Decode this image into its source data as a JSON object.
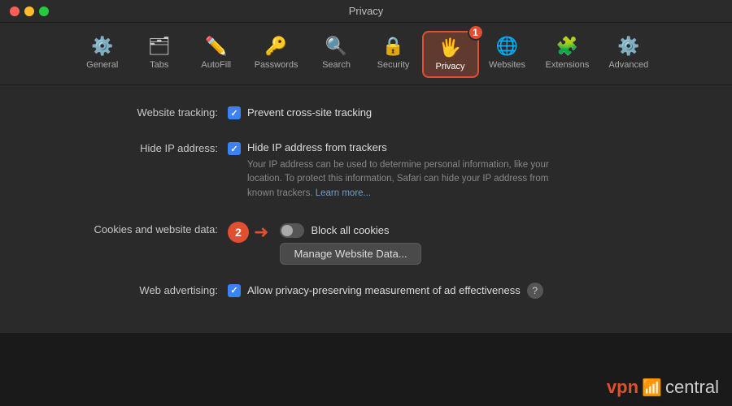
{
  "titlebar": {
    "title": "Privacy"
  },
  "toolbar": {
    "items": [
      {
        "id": "general",
        "label": "General",
        "icon": "⚙️"
      },
      {
        "id": "tabs",
        "label": "Tabs",
        "icon": "🗂"
      },
      {
        "id": "autofill",
        "label": "AutoFill",
        "icon": "✏️"
      },
      {
        "id": "passwords",
        "label": "Passwords",
        "icon": "🔑"
      },
      {
        "id": "search",
        "label": "Search",
        "icon": "🔍"
      },
      {
        "id": "security",
        "label": "Security",
        "icon": "🔒"
      },
      {
        "id": "privacy",
        "label": "Privacy",
        "icon": "🖐",
        "active": true
      },
      {
        "id": "websites",
        "label": "Websites",
        "icon": "🌐"
      },
      {
        "id": "extensions",
        "label": "Extensions",
        "icon": "🧩"
      },
      {
        "id": "advanced",
        "label": "Advanced",
        "icon": "⚙️"
      }
    ],
    "step1_badge": "1"
  },
  "settings": {
    "website_tracking": {
      "label": "Website tracking:",
      "text": "Prevent cross-site tracking"
    },
    "hide_ip": {
      "label": "Hide IP address:",
      "text": "Hide IP address from trackers",
      "description": "Your IP address can be used to determine personal information, like your location. To protect this information, Safari can hide your IP address from known trackers.",
      "learn_more": "Learn more..."
    },
    "cookies": {
      "label": "Cookies and website data:",
      "block_text": "Block all cookies",
      "manage_button": "Manage Website Data..."
    },
    "web_advertising": {
      "label": "Web advertising:",
      "text": "Allow privacy-preserving measurement of ad effectiveness"
    }
  },
  "annotations": {
    "step2": "2"
  },
  "watermark": {
    "vpn": "vpn",
    "central": "central"
  }
}
